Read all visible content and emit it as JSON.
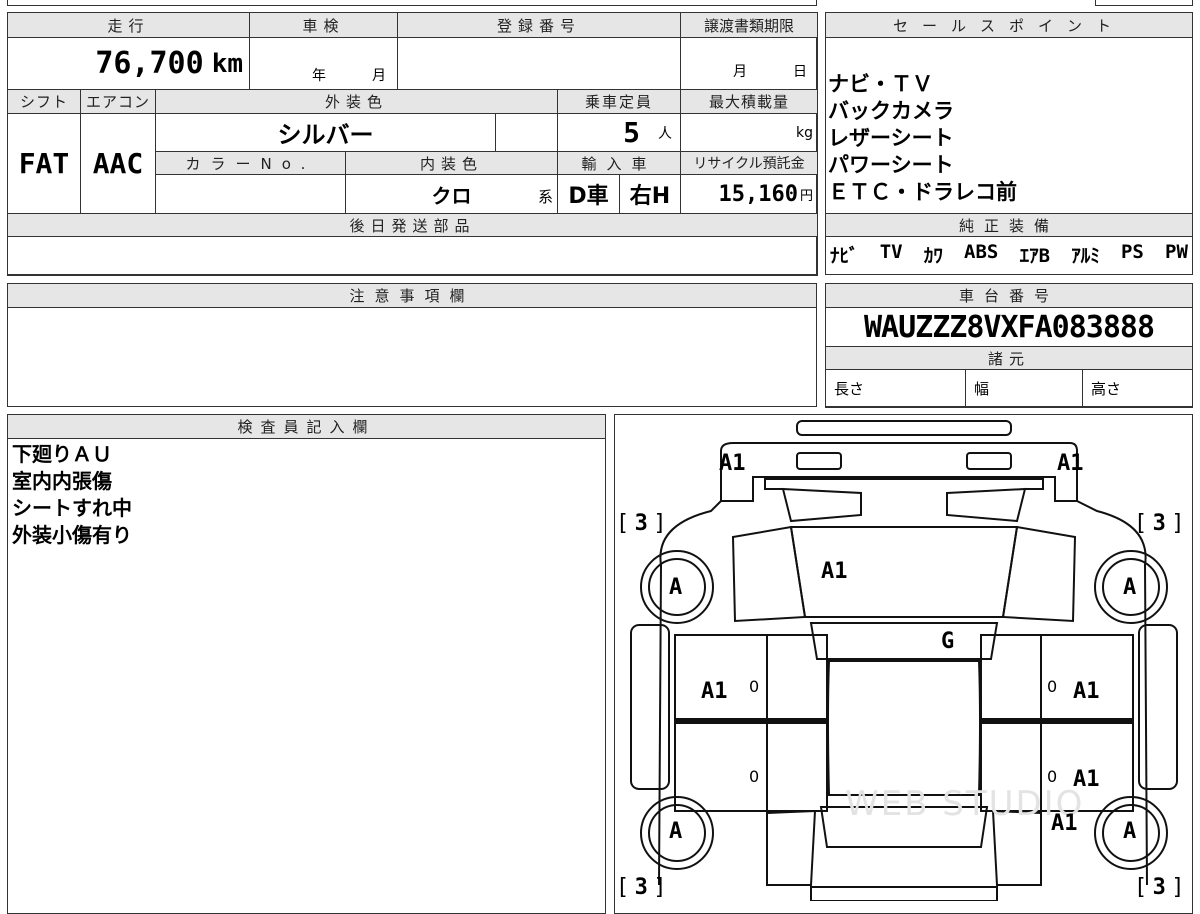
{
  "vehicle": {
    "mileage_label": "走行",
    "mileage_value": "76,700",
    "mileage_unit": "km",
    "inspection_label": "車検",
    "inspection_year_unit": "年",
    "inspection_month_unit": "月",
    "registration_label": "登録番号",
    "transfer_deadline_label": "譲渡書類期限",
    "transfer_month_unit": "月",
    "transfer_day_unit": "日",
    "shift_label": "シフト",
    "shift_value": "FAT",
    "aircon_label": "エアコン",
    "aircon_value": "AAC",
    "exterior_color_label": "外装色",
    "exterior_color_value": "シルバー",
    "capacity_label": "乗車定員",
    "capacity_value": "5",
    "capacity_unit": "人",
    "max_load_label": "最大積載量",
    "max_load_unit": "kg",
    "color_no_label": "カラーNo.",
    "interior_color_label": "内装色",
    "interior_color_value": "クロ",
    "interior_color_suffix": "系",
    "import_label": "輸入車",
    "import_value": "D車",
    "handle_value": "右H",
    "recycle_label": "リサイクル預託金",
    "recycle_value": "15,160",
    "recycle_unit": "円",
    "later_parts_label": "後日発送部品"
  },
  "sales_points": {
    "label": "セールスポイント",
    "items": [
      "ナビ・ＴＶ",
      "バックカメラ",
      "レザーシート",
      "パワーシート",
      "ＥＴＣ・ドラレコ前"
    ]
  },
  "genuine_equipment": {
    "label": "純正装備",
    "items": [
      "ﾅﾋﾞ",
      "TV",
      "ｶﾜ",
      "ABS",
      "ｴｱB",
      "ｱﾙﾐ",
      "PS",
      "PW"
    ]
  },
  "notes": {
    "label": "注意事項欄"
  },
  "chassis": {
    "label": "車台番号",
    "value": "WAUZZZ8VXFA083888",
    "specs_label": "諸元",
    "length_label": "長さ",
    "width_label": "幅",
    "height_label": "高さ"
  },
  "inspector": {
    "label": "検査員記入欄",
    "lines": [
      "下廻りＡＵ",
      "室内内張傷",
      "シートすれ中",
      "外装小傷有り"
    ]
  },
  "diagram": {
    "marks": {
      "front_left": "A1",
      "front_right": "A1",
      "hood": "A1",
      "windshield": "G",
      "front_door_left": "A1",
      "front_door_right": "A1",
      "rear_door_right": "A1",
      "rear_quarter_right": "A1",
      "wheel": "A",
      "tire": "3",
      "door_zero": "0"
    },
    "watermark": "WEB STUDIO"
  }
}
